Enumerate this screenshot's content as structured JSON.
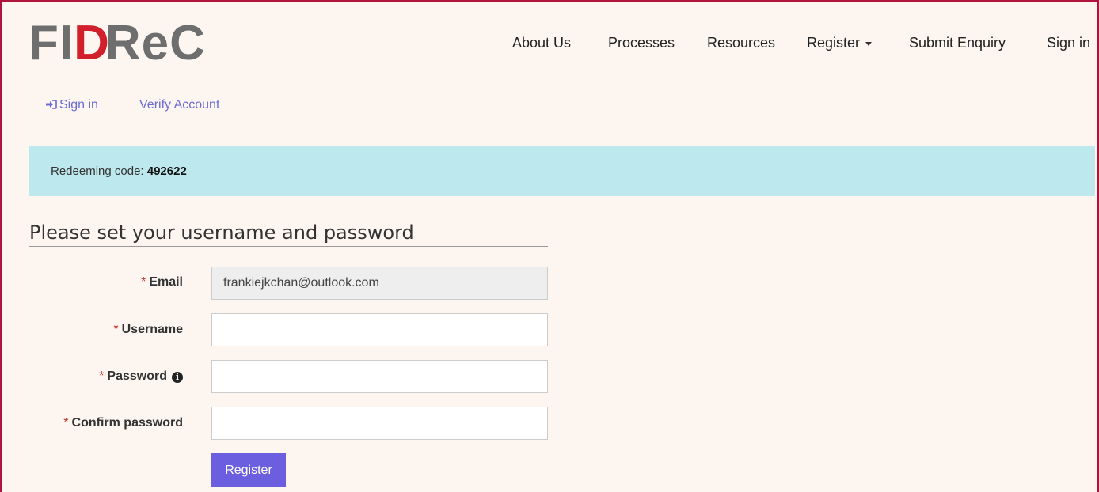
{
  "brand": {
    "logo_parts": [
      "FI",
      "D",
      "ReC"
    ]
  },
  "nav": {
    "items": [
      "About Us",
      "Processes",
      "Resources",
      "Register",
      "Submit Enquiry",
      "Sign in"
    ]
  },
  "subnav": {
    "sign_in": "Sign in",
    "verify_account": "Verify Account"
  },
  "alert": {
    "prefix": "Redeeming code:",
    "code": "492622"
  },
  "form": {
    "title": "Please set your username and password",
    "required_mark": "*",
    "email_label": "Email",
    "email_value": "frankiejkchan@outlook.com",
    "username_label": "Username",
    "password_label": "Password",
    "confirm_label": "Confirm password",
    "info_icon_glyph": "i",
    "submit_label": "Register"
  },
  "colors": {
    "accent": "#6b5fe0",
    "border": "#b0143c",
    "alert_bg": "#bde8ee",
    "logo_red": "#d11f2b",
    "logo_grey": "#6e6e6e"
  }
}
